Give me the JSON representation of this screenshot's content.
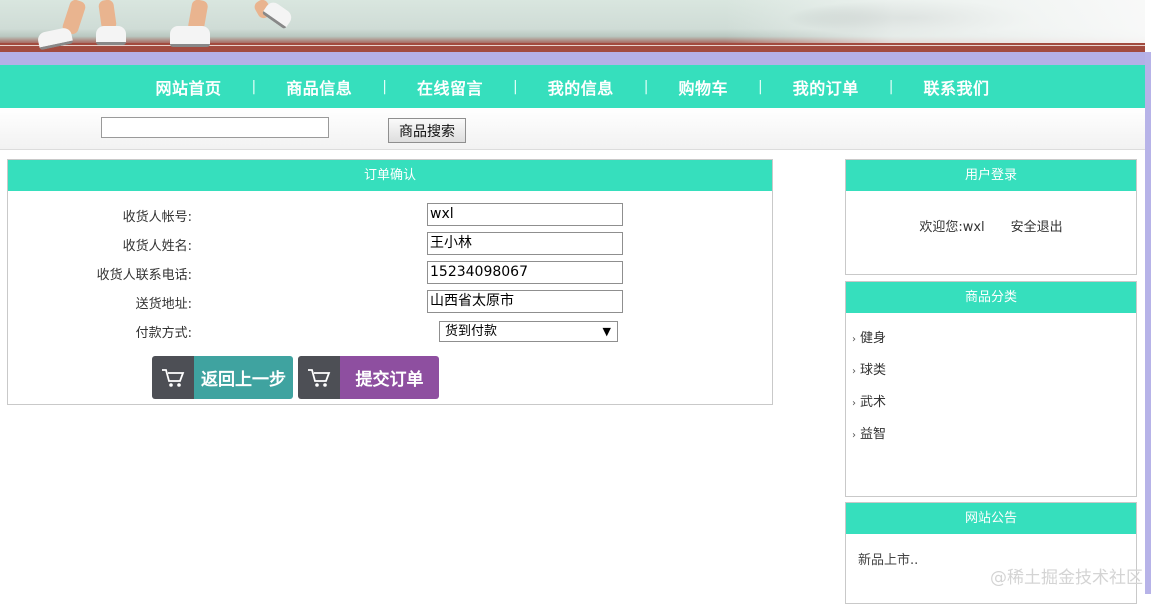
{
  "nav": {
    "items": [
      "网站首页",
      "商品信息",
      "在线留言",
      "我的信息",
      "购物车",
      "我的订单",
      "联系我们"
    ],
    "separator": "|"
  },
  "search": {
    "value": "",
    "button_label": "商品搜索"
  },
  "order": {
    "title": "订单确认",
    "fields": [
      {
        "label": "收货人帐号:",
        "value": "wxl"
      },
      {
        "label": "收货人姓名:",
        "value": "王小林"
      },
      {
        "label": "收货人联系电话:",
        "value": "15234098067"
      },
      {
        "label": "送货地址:",
        "value": "山西省太原市"
      }
    ],
    "payment": {
      "label": "付款方式:",
      "selected": "货到付款"
    },
    "back_label": "返回上一步",
    "submit_label": "提交订单"
  },
  "login": {
    "title": "用户登录",
    "welcome": "欢迎您:",
    "username": "wxl",
    "logout_label": "安全退出"
  },
  "category": {
    "title": "商品分类",
    "items": [
      "健身",
      "球类",
      "武术",
      "益智"
    ]
  },
  "notice": {
    "title": "网站公告",
    "text": "新品上市.."
  },
  "watermark": "@稀土掘金技术社区",
  "colors": {
    "accent": "#36dfbd",
    "back_button": "#3fa3a0",
    "submit_button": "#8e4fa0"
  }
}
